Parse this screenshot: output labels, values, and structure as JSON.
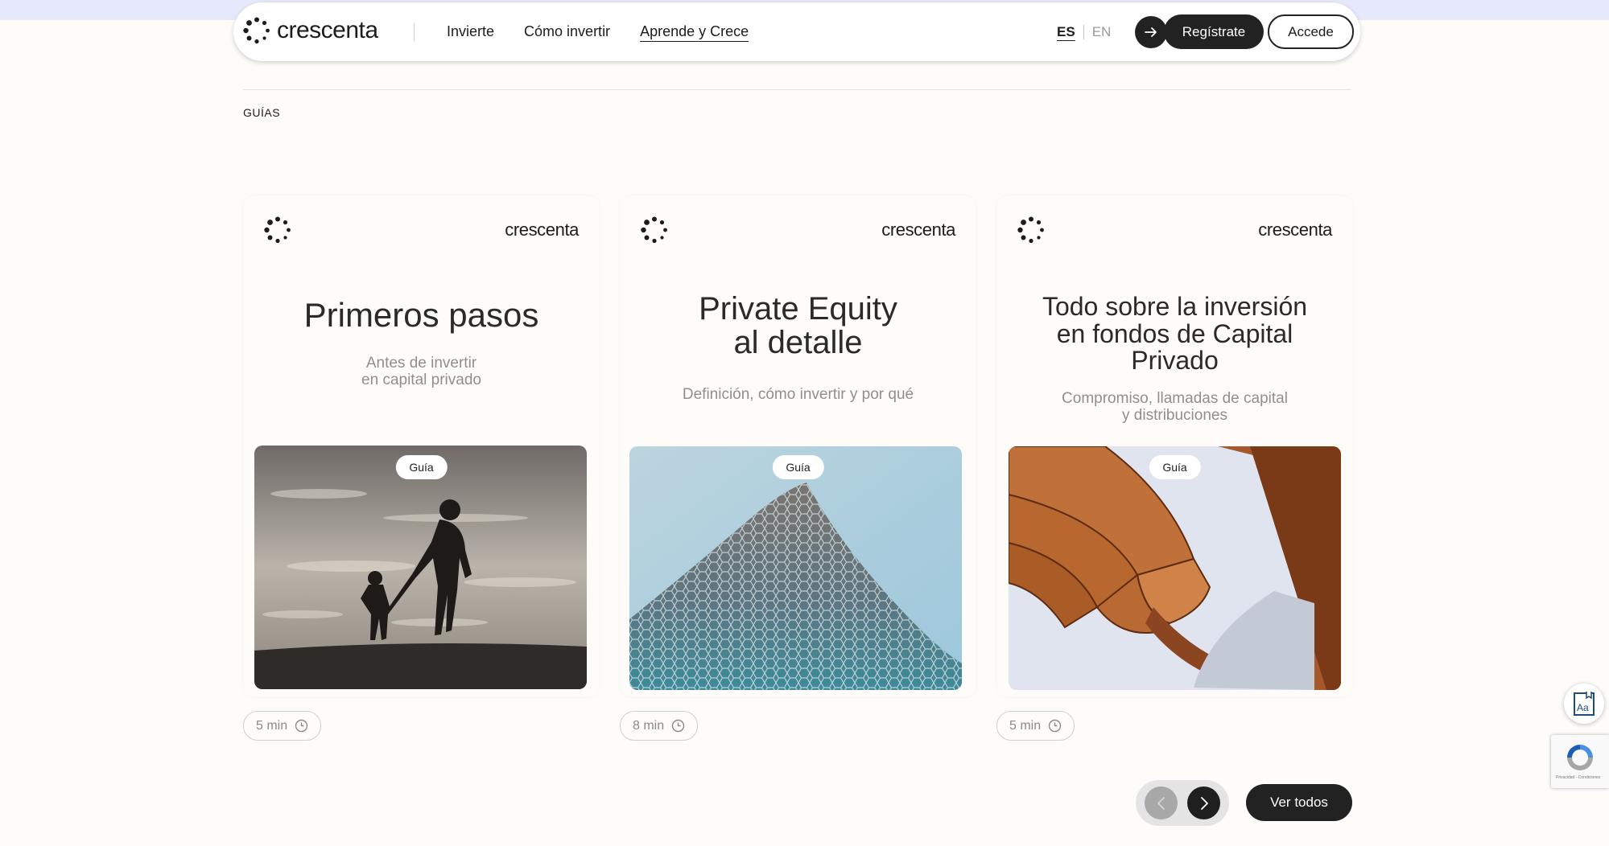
{
  "nav": {
    "logo_text": "crescenta",
    "links": [
      "Invierte",
      "Cómo invertir",
      "Aprende y Crece"
    ],
    "active_link": "Aprende y Crece",
    "lang_es": "ES",
    "lang_en": "EN",
    "register_label": "Regístrate",
    "login_label": "Accede"
  },
  "section": {
    "label": "GUÍAS"
  },
  "cards": [
    {
      "brand": "crescenta",
      "title_line1": "Primeros pasos",
      "title_line2": "",
      "title_line3": "",
      "subtitle_line1": "Antes de invertir",
      "subtitle_line2": "en capital privado",
      "badge": "Guía",
      "duration": "5 min"
    },
    {
      "brand": "crescenta",
      "title_line1": "Private Equity",
      "title_line2": "al detalle",
      "title_line3": "",
      "subtitle_line1": "Definición, cómo invertir y por qué",
      "subtitle_line2": "",
      "badge": "Guía",
      "duration": "8 min"
    },
    {
      "brand": "crescenta",
      "title_line1": "Todo sobre la inversión",
      "title_line2": "en fondos de Capital",
      "title_line3": "Privado",
      "subtitle_line1": "Compromiso, llamadas de capital",
      "subtitle_line2": "y distribuciones",
      "badge": "Guía",
      "duration": "5 min"
    }
  ],
  "controls": {
    "view_all_label": "Ver todos"
  },
  "widgets": {
    "accessibility_icon": "Aa",
    "recaptcha_text": "Privacidad - Condiciones"
  },
  "icons": [
    "logo-dots-icon",
    "arrow-right-icon",
    "clock-icon",
    "chevron-left-icon",
    "chevron-right-icon",
    "accessibility-icon",
    "recaptcha-icon"
  ],
  "colors": {
    "background": "#fdfcf8",
    "top_band": "#e6e9fb",
    "dark": "#222222",
    "muted": "#8f8f8f"
  }
}
